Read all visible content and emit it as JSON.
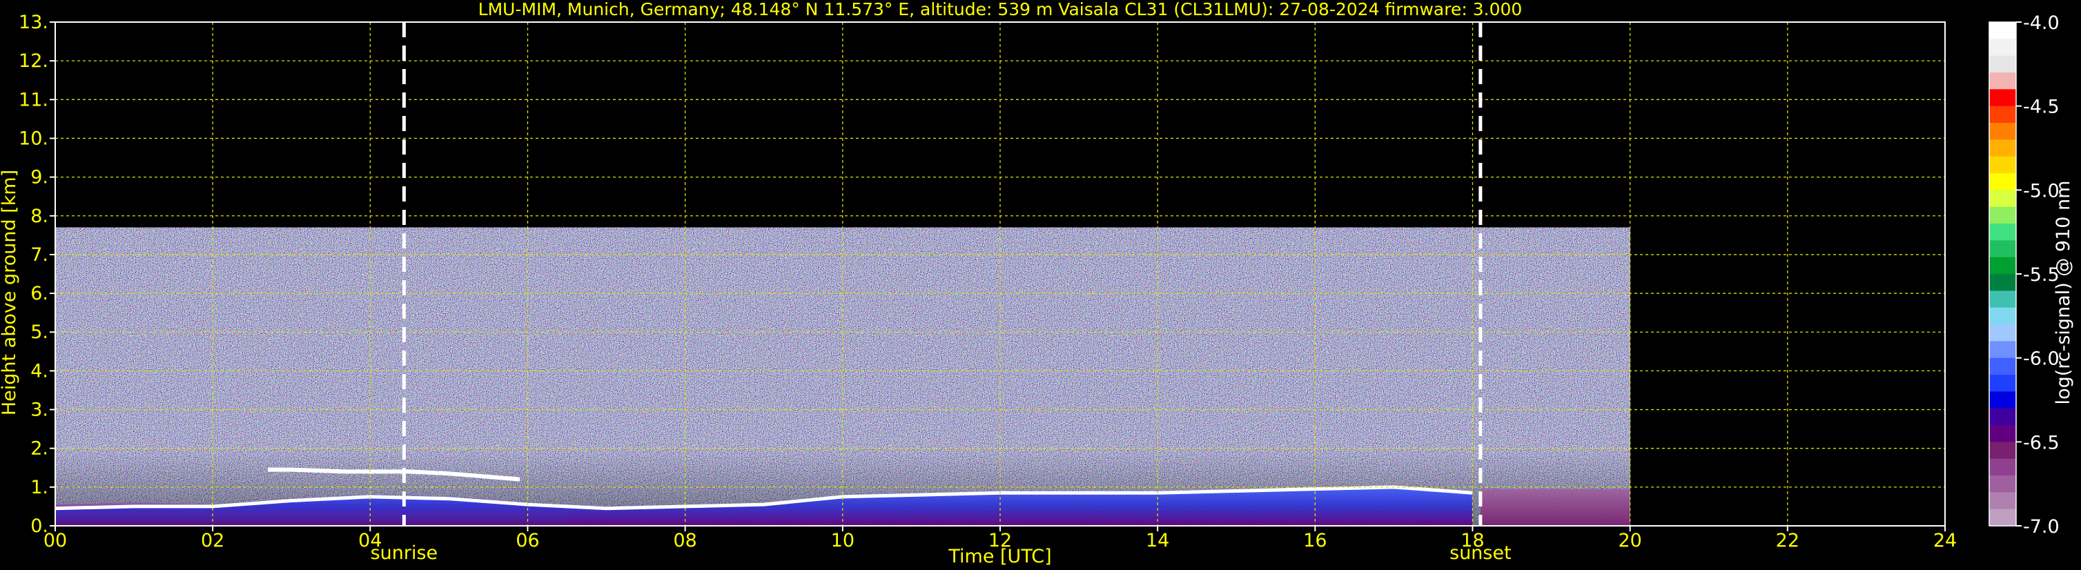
{
  "chart_data": {
    "type": "heatmap",
    "title": "LMU-MIM, Munich, Germany; 48.148° N 11.573° E, altitude: 539 m    Vaisala CL31 (CL31LMU): 27-08-2024    firmware: 3.000",
    "xlabel": "Time [UTC]",
    "ylabel": "Height above ground [km]",
    "xlim": [
      0,
      24
    ],
    "ylim": [
      0,
      13
    ],
    "x_ticks": [
      "00",
      "02",
      "04",
      "06",
      "08",
      "10",
      "12",
      "14",
      "16",
      "18",
      "20",
      "22",
      "24"
    ],
    "y_ticks": [
      "0.",
      "1.",
      "2.",
      "3.",
      "4.",
      "5.",
      "6.",
      "7.",
      "8.",
      "9.",
      "10.",
      "11.",
      "12.",
      "13."
    ],
    "grid": true,
    "data_extent": {
      "time_end": 20.0,
      "height_max": 7.7
    },
    "markers": [
      {
        "label": "sunrise",
        "time": 4.43
      },
      {
        "label": "sunset",
        "time": 18.1
      }
    ],
    "boundary_layer_top": {
      "time": [
        0.0,
        1.0,
        2.0,
        3.0,
        4.0,
        5.0,
        6.0,
        7.0,
        8.0,
        9.0,
        10.0,
        11.0,
        12.0,
        13.0,
        14.0,
        15.0,
        16.0,
        17.0,
        18.0
      ],
      "height": [
        0.45,
        0.5,
        0.5,
        0.65,
        0.75,
        0.7,
        0.55,
        0.45,
        0.5,
        0.55,
        0.75,
        0.8,
        0.85,
        0.85,
        0.85,
        0.9,
        0.95,
        1.0,
        0.85
      ]
    },
    "residual_layer": {
      "time": [
        2.7,
        3.0,
        3.7,
        4.5,
        5.0,
        5.9
      ],
      "height": [
        1.45,
        1.45,
        1.4,
        1.4,
        1.35,
        1.2
      ]
    },
    "colorbar": {
      "label": "log(rc-signal) @ 910 nm",
      "min": -7.0,
      "max": -4.0,
      "ticks": [
        "-4.0",
        "-4.5",
        "-5.0",
        "-5.5",
        "-6.0",
        "-6.5",
        "-7.0"
      ],
      "colors_top_to_bottom": [
        "#ffffff",
        "#f2f2f2",
        "#e6e6e6",
        "#f2b3b3",
        "#ff0000",
        "#ff4000",
        "#ff8000",
        "#ffb000",
        "#ffd700",
        "#ffff00",
        "#d8ff40",
        "#90ee60",
        "#40e080",
        "#20c060",
        "#00a030",
        "#008040",
        "#40c0b0",
        "#80d8f0",
        "#a0c8ff",
        "#7090ff",
        "#4060ff",
        "#2040ff",
        "#0000e0",
        "#4000a0",
        "#600080",
        "#7a2070",
        "#904090",
        "#a060a0",
        "#b080b0",
        "#c0a0c0"
      ]
    },
    "colors": {
      "text": "#ffff00",
      "grid": "#e0e000",
      "background": "#000000",
      "axis": "#ffffff"
    }
  }
}
